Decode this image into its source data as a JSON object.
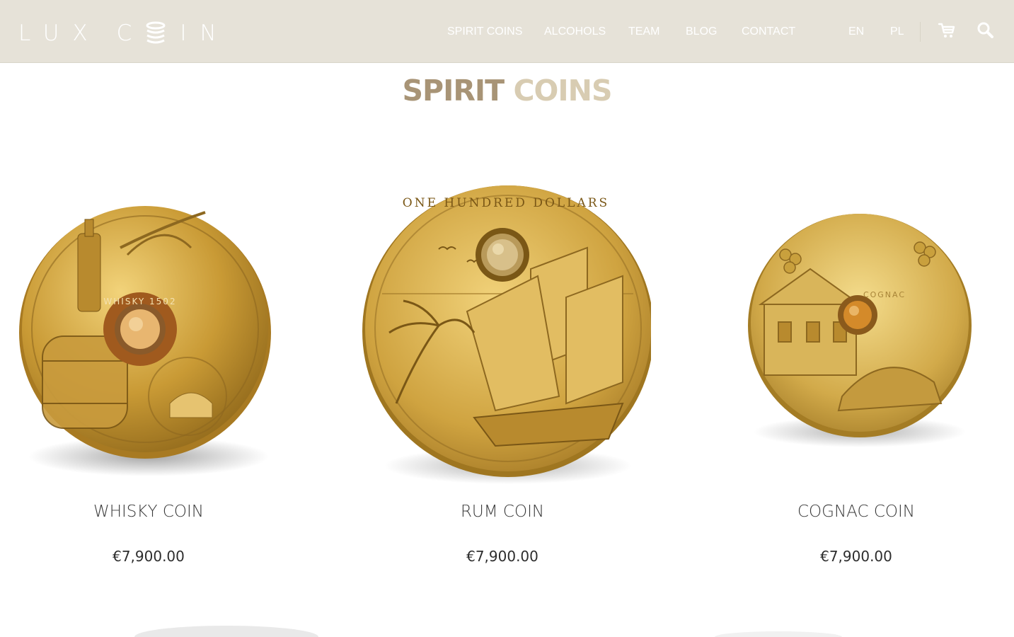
{
  "brand": {
    "logo_part1": "LUX",
    "logo_part2_letters": "IN"
  },
  "nav": {
    "items": [
      {
        "label": "SPIRIT COINS"
      },
      {
        "label": "ALCOHOLS"
      },
      {
        "label": "TEAM"
      },
      {
        "label": "BLOG"
      },
      {
        "label": "CONTACT"
      }
    ]
  },
  "lang": {
    "en": "EN",
    "pl": "PL"
  },
  "icons": {
    "cart": "cart-icon",
    "search": "search-icon"
  },
  "page": {
    "title_part1": "SPIRIT",
    "title_part2": "COINS"
  },
  "colors": {
    "header_bg": "#e6e2d8",
    "title_dark": "#a89476",
    "title_light": "#d8ccb2",
    "gold": "#c9a23c"
  },
  "products": [
    {
      "name": "WHISKY COIN",
      "price": "€7,900.00",
      "coin_inscription": "WHISKY 1502"
    },
    {
      "name": "RUM COIN",
      "price": "€7,900.00",
      "coin_inscription": "ONE HUNDRED DOLLARS"
    },
    {
      "name": "COGNAC COIN",
      "price": "€7,900.00",
      "coin_inscription": "COGNAC"
    }
  ]
}
